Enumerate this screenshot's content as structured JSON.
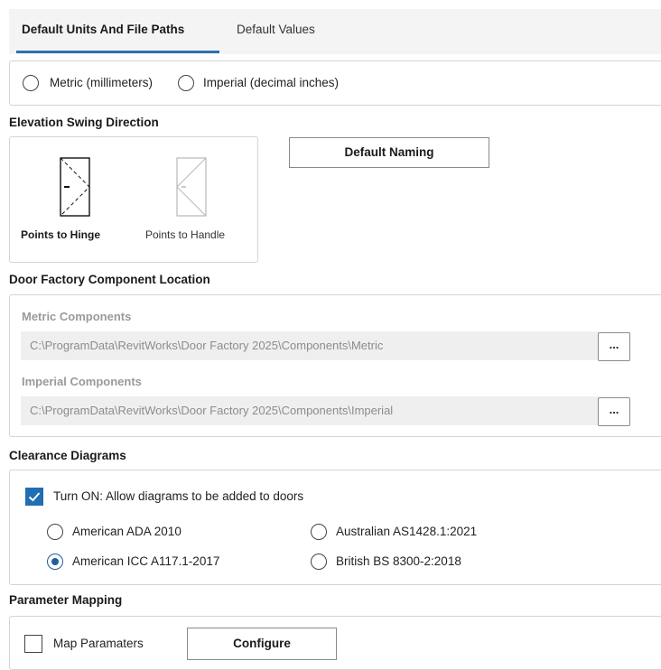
{
  "tabs": {
    "units_paths": "Default Units And File Paths",
    "values": "Default Values"
  },
  "units": {
    "metric_label": "Metric (millimeters)",
    "imperial_label": "Imperial (decimal inches)",
    "selected": "none"
  },
  "swing": {
    "header": "Elevation Swing Direction",
    "hinge_label": "Points to Hinge",
    "handle_label": "Points to Handle",
    "selected": "hinge",
    "default_naming_button": "Default Naming"
  },
  "components": {
    "header": "Door Factory Component Location",
    "metric_label": "Metric Components",
    "metric_path": "C:\\ProgramData\\RevitWorks\\Door Factory 2025\\Components\\Metric",
    "imperial_label": "Imperial Components",
    "imperial_path": "C:\\ProgramData\\RevitWorks\\Door Factory 2025\\Components\\Imperial",
    "browse_label": "..."
  },
  "clearance": {
    "header": "Clearance Diagrams",
    "enable_label": "Turn ON: Allow diagrams to be added to doors",
    "enabled": true,
    "options": {
      "ada": "American ADA 2010",
      "icc": "American ICC A117.1-2017",
      "as1428": "Australian AS1428.1:2021",
      "bs8300": "British BS 8300-2:2018"
    },
    "selected": "icc"
  },
  "parameters": {
    "header": "Parameter Mapping",
    "map_label": "Map Paramaters",
    "map_checked": false,
    "configure_button": "Configure"
  },
  "colors": {
    "accent": "#1f6fb2",
    "tab_underline": "#2f6fb0",
    "disabled_field": "#efefef"
  }
}
